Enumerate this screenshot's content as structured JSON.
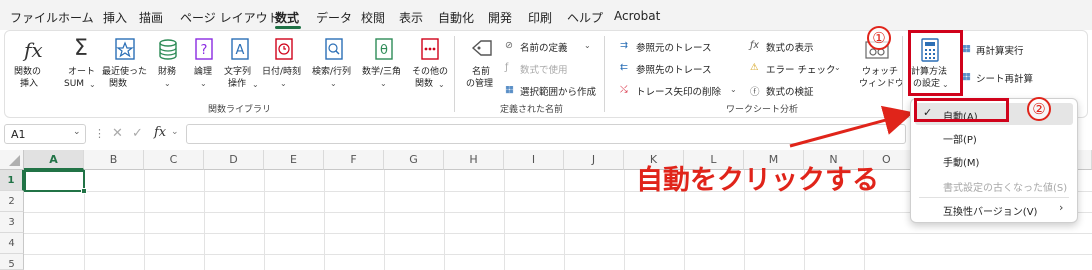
{
  "menu": {
    "tabs": [
      "ファイル",
      "ホーム",
      "挿入",
      "描画",
      "ページ レイアウト",
      "数式",
      "データ",
      "校閲",
      "表示",
      "自動化",
      "開発",
      "印刷",
      "ヘルプ",
      "Acrobat"
    ],
    "active_tab": "数式"
  },
  "ribbon": {
    "function_library": {
      "insert_function": [
        "関数の",
        "挿入"
      ],
      "autosum": [
        "オート",
        "SUM"
      ],
      "recent": [
        "最近使った",
        "関数"
      ],
      "financial": "財務",
      "logical": "論理",
      "text": [
        "文字列",
        "操作"
      ],
      "datetime": "日付/時刻",
      "lookup": "検索/行列",
      "math": "数学/三角",
      "more": [
        "その他の",
        "関数"
      ],
      "group_label": "関数ライブラリ"
    },
    "defined_names": {
      "name_manager": [
        "名前",
        "の管理"
      ],
      "define_name": "名前の定義",
      "use_in_formula": "数式で使用",
      "create_from_selection": "選択範囲から作成",
      "group_label": "定義された名前"
    },
    "formula_auditing": {
      "trace_precedents": "参照元のトレース",
      "trace_dependents": "参照先のトレース",
      "remove_arrows": "トレース矢印の削除",
      "show_formulas": "数式の表示",
      "error_checking": "エラー チェック",
      "evaluate_formula": "数式の検証",
      "watch_window": [
        "ウォッチ",
        "ウィンドウ"
      ],
      "group_label": "ワークシート分析"
    },
    "calculation": {
      "options": [
        "計算方法",
        "の設定"
      ],
      "calc_now": "再計算実行",
      "calc_sheet": "シート再計算"
    }
  },
  "formula_bar": {
    "name_box": "A1",
    "fx": "fx",
    "value": ""
  },
  "grid": {
    "columns": [
      "A",
      "B",
      "C",
      "D",
      "E",
      "F",
      "G",
      "H",
      "I",
      "J",
      "K",
      "L",
      "M",
      "N",
      "O"
    ],
    "rows": [
      "1",
      "2",
      "3",
      "4",
      "5"
    ],
    "selected_cell": "A1"
  },
  "dropdown": {
    "items": [
      {
        "label": "自動(A)",
        "checked": true,
        "disabled": false
      },
      {
        "label": "一部(P)",
        "checked": false,
        "disabled": false
      },
      {
        "label": "手動(M)",
        "checked": false,
        "disabled": false
      },
      {
        "label": "書式設定の古くなった値(S)",
        "checked": false,
        "disabled": true
      },
      {
        "label": "互換性バージョン(V)",
        "checked": false,
        "disabled": false
      }
    ]
  },
  "annotation": {
    "step1": "①",
    "step2": "②",
    "text": "自動をクリックする"
  },
  "colors": {
    "accent_green": "#1e7145",
    "annotation_red": "#e0241a",
    "selection_green": "#217346"
  }
}
